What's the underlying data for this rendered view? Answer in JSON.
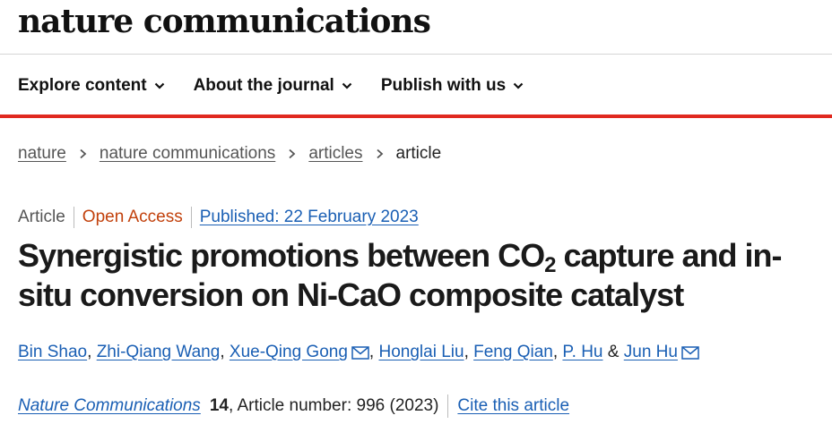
{
  "header": {
    "brand": "nature communications"
  },
  "nav": {
    "items": [
      {
        "label": "Explore content",
        "icon": "chevron-down-icon"
      },
      {
        "label": "About the journal",
        "icon": "chevron-down-icon"
      },
      {
        "label": "Publish with us",
        "icon": "chevron-down-icon"
      }
    ]
  },
  "colors": {
    "accent_bar": "#e0291f",
    "link": "#1a5fb4",
    "open_access": "#c2410c"
  },
  "breadcrumb": {
    "items": [
      "nature",
      "nature communications",
      "articles"
    ],
    "current": "article"
  },
  "article": {
    "type": "Article",
    "access": "Open Access",
    "published": "Published: 22 February 2023",
    "title_part1": "Synergistic promotions between CO",
    "title_sub": "2",
    "title_part2": " capture and in-situ conversion on Ni-CaO composite catalyst",
    "authors": [
      "Bin Shao",
      "Zhi-Qiang Wang",
      "Xue-Qing Gong",
      "Honglai Liu",
      "Feng Qian",
      "P. Hu",
      "Jun Hu"
    ],
    "author_separator": ",",
    "author_last_separator": "&",
    "citation": {
      "journal": "Nature Communications",
      "volume": "14",
      "rest": ", Article number: 996 (2023)",
      "cite_link": "Cite this article"
    }
  }
}
